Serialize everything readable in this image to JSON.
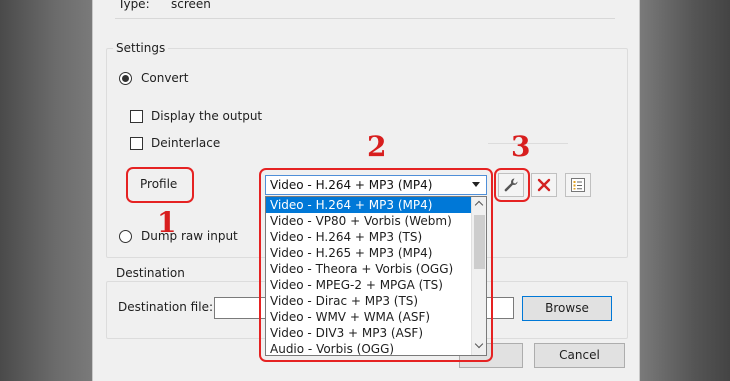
{
  "source": {
    "type_label": "Type:",
    "type_value": "screen"
  },
  "settings": {
    "group_label": "Settings",
    "convert_label": "Convert",
    "display_output_label": "Display the output",
    "deinterlace_label": "Deinterlace",
    "profile_label": "Profile",
    "dump_raw_label": "Dump raw input"
  },
  "profile_select": {
    "selected": "Video - H.264 + MP3 (MP4)",
    "options": [
      "Video - H.264 + MP3 (MP4)",
      "Video - VP80 + Vorbis (Webm)",
      "Video - H.264 + MP3 (TS)",
      "Video - H.265 + MP3 (MP4)",
      "Video - Theora + Vorbis (OGG)",
      "Video - MPEG-2 + MPGA (TS)",
      "Video - Dirac + MP3 (TS)",
      "Video - WMV + WMA (ASF)",
      "Video - DIV3 + MP3 (ASF)",
      "Audio - Vorbis (OGG)"
    ]
  },
  "destination": {
    "group_label": "Destination",
    "file_label": "Destination file:",
    "file_value": "",
    "browse_label": "Browse"
  },
  "footer": {
    "cancel_label": "Cancel"
  },
  "annotations": {
    "n1": "1",
    "n2": "2",
    "n3": "3"
  },
  "colors": {
    "annotation_red": "#e52222",
    "selection_blue": "#0078d7"
  },
  "icons": {
    "edit_profile": "wrench-icon",
    "delete_profile": "red-x-icon",
    "new_profile": "list-icon"
  }
}
